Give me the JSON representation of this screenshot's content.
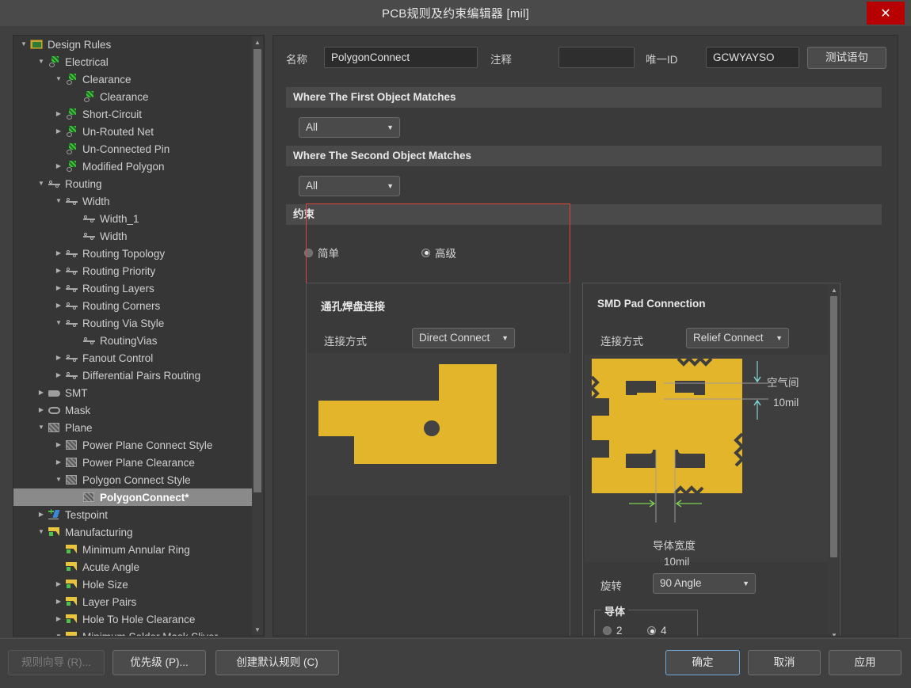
{
  "window": {
    "title": "PCB规则及约束编辑器 [mil]",
    "close_label": "✕"
  },
  "tree": {
    "items": [
      {
        "label": "Design Rules",
        "depth": 0,
        "arrow": "down",
        "icon": "folder-icon",
        "selected": false
      },
      {
        "label": "Electrical",
        "depth": 1,
        "arrow": "down",
        "icon": "electrical-icon",
        "selected": false
      },
      {
        "label": "Clearance",
        "depth": 2,
        "arrow": "down",
        "icon": "electrical-icon",
        "selected": false
      },
      {
        "label": "Clearance",
        "depth": 3,
        "arrow": "none",
        "icon": "electrical-icon",
        "selected": false
      },
      {
        "label": "Short-Circuit",
        "depth": 2,
        "arrow": "right",
        "icon": "electrical-icon",
        "selected": false
      },
      {
        "label": "Un-Routed Net",
        "depth": 2,
        "arrow": "right",
        "icon": "electrical-icon",
        "selected": false
      },
      {
        "label": "Un-Connected Pin",
        "depth": 2,
        "arrow": "none",
        "icon": "electrical-icon",
        "selected": false
      },
      {
        "label": "Modified Polygon",
        "depth": 2,
        "arrow": "right",
        "icon": "electrical-icon",
        "selected": false
      },
      {
        "label": "Routing",
        "depth": 1,
        "arrow": "down",
        "icon": "routing-icon",
        "selected": false
      },
      {
        "label": "Width",
        "depth": 2,
        "arrow": "down",
        "icon": "routing-icon",
        "selected": false
      },
      {
        "label": "Width_1",
        "depth": 3,
        "arrow": "none",
        "icon": "routing-icon",
        "selected": false
      },
      {
        "label": "Width",
        "depth": 3,
        "arrow": "none",
        "icon": "routing-icon",
        "selected": false
      },
      {
        "label": "Routing Topology",
        "depth": 2,
        "arrow": "right",
        "icon": "routing-icon",
        "selected": false
      },
      {
        "label": "Routing Priority",
        "depth": 2,
        "arrow": "right",
        "icon": "routing-icon",
        "selected": false
      },
      {
        "label": "Routing Layers",
        "depth": 2,
        "arrow": "right",
        "icon": "routing-icon",
        "selected": false
      },
      {
        "label": "Routing Corners",
        "depth": 2,
        "arrow": "right",
        "icon": "routing-icon",
        "selected": false
      },
      {
        "label": "Routing Via Style",
        "depth": 2,
        "arrow": "down",
        "icon": "routing-icon",
        "selected": false
      },
      {
        "label": "RoutingVias",
        "depth": 3,
        "arrow": "none",
        "icon": "routing-icon",
        "selected": false
      },
      {
        "label": "Fanout Control",
        "depth": 2,
        "arrow": "right",
        "icon": "routing-icon",
        "selected": false
      },
      {
        "label": "Differential Pairs Routing",
        "depth": 2,
        "arrow": "right",
        "icon": "routing-icon",
        "selected": false
      },
      {
        "label": "SMT",
        "depth": 1,
        "arrow": "right",
        "icon": "smt-icon",
        "selected": false
      },
      {
        "label": "Mask",
        "depth": 1,
        "arrow": "right",
        "icon": "mask-icon",
        "selected": false
      },
      {
        "label": "Plane",
        "depth": 1,
        "arrow": "down",
        "icon": "plane-icon",
        "selected": false
      },
      {
        "label": "Power Plane Connect Style",
        "depth": 2,
        "arrow": "right",
        "icon": "plane-icon",
        "selected": false
      },
      {
        "label": "Power Plane Clearance",
        "depth": 2,
        "arrow": "right",
        "icon": "plane-icon",
        "selected": false
      },
      {
        "label": "Polygon Connect Style",
        "depth": 2,
        "arrow": "down",
        "icon": "plane-icon",
        "selected": false
      },
      {
        "label": "PolygonConnect*",
        "depth": 3,
        "arrow": "none",
        "icon": "plane-icon",
        "selected": true
      },
      {
        "label": "Testpoint",
        "depth": 1,
        "arrow": "right",
        "icon": "testpoint-icon",
        "selected": false
      },
      {
        "label": "Manufacturing",
        "depth": 1,
        "arrow": "down",
        "icon": "manufacturing-icon",
        "selected": false
      },
      {
        "label": "Minimum Annular Ring",
        "depth": 2,
        "arrow": "none",
        "icon": "manufacturing-icon",
        "selected": false
      },
      {
        "label": "Acute Angle",
        "depth": 2,
        "arrow": "none",
        "icon": "manufacturing-icon",
        "selected": false
      },
      {
        "label": "Hole Size",
        "depth": 2,
        "arrow": "right",
        "icon": "manufacturing-icon",
        "selected": false
      },
      {
        "label": "Layer Pairs",
        "depth": 2,
        "arrow": "right",
        "icon": "manufacturing-icon",
        "selected": false
      },
      {
        "label": "Hole To Hole Clearance",
        "depth": 2,
        "arrow": "right",
        "icon": "manufacturing-icon",
        "selected": false
      },
      {
        "label": "Minimum Solder Mask Sliver",
        "depth": 2,
        "arrow": "down",
        "icon": "manufacturing-icon",
        "selected": false
      }
    ]
  },
  "form": {
    "name_label": "名称",
    "name_value": "PolygonConnect",
    "comment_label": "注释",
    "comment_value": "",
    "unique_id_label": "唯一ID",
    "unique_id_value": "GCWYAYSO",
    "test_query_button": "测试语句"
  },
  "first_object": {
    "header": "Where The First Object Matches",
    "scope_value": "All"
  },
  "second_object": {
    "header": "Where The Second Object Matches",
    "scope_value": "All"
  },
  "constraints": {
    "header": "约束",
    "mode_simple": "简单",
    "mode_advanced": "高级",
    "selected_mode": "高级",
    "through_hole": {
      "title": "通孔焊盘连接",
      "connect_label": "连接方式",
      "connect_value": "Direct Connect"
    },
    "smd": {
      "title": "SMD Pad Connection",
      "connect_label": "连接方式",
      "connect_value": "Relief Connect",
      "air_gap_label": "空气间",
      "air_gap_value": "10mil",
      "conductor_width_label": "导体宽度",
      "conductor_width_value": "10mil",
      "rotation_label": "旋转",
      "rotation_value": "90 Angle",
      "conductors_group_label": "导体",
      "conductors_option_2": "2",
      "conductors_option_4": "4",
      "conductors_selected": "4"
    }
  },
  "footer": {
    "rule_wizard": "规则向导 (R)...",
    "priorities": "优先级 (P)...",
    "create_default_rules": "创建默认规则 (C)",
    "ok": "确定",
    "cancel": "取消",
    "apply": "应用"
  },
  "colors": {
    "pad_yellow": "#e3b52a",
    "accent_red": "#e0453a",
    "close_red": "#b70000",
    "focus_blue": "#6fa8dc",
    "dim_cyan": "#7fd6d6",
    "dim_green": "#7ccf52"
  }
}
